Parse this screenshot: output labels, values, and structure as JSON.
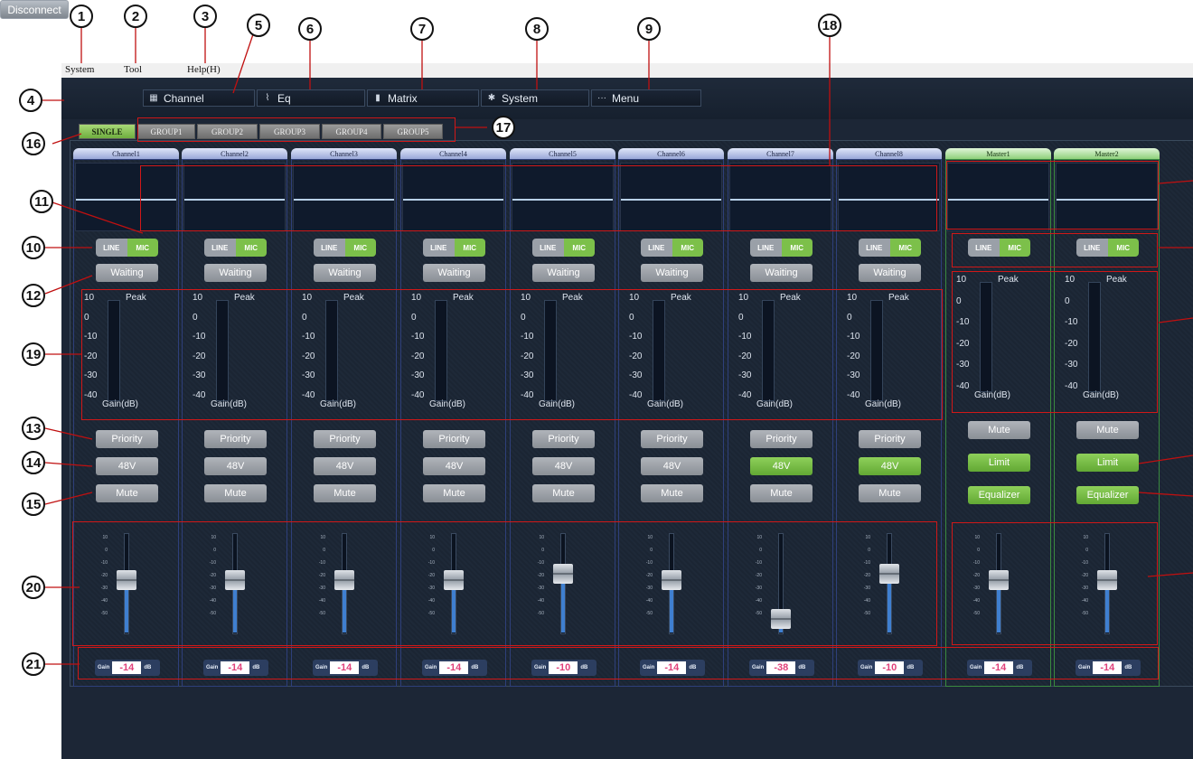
{
  "menu": {
    "system": "System",
    "tool": "Tool",
    "help": "Help(H)"
  },
  "toolbar": {
    "disconnect": "Disconnect",
    "channel": "Channel",
    "eq": "Eq",
    "matrix": "Matrix",
    "system": "System",
    "menu": "Menu"
  },
  "tabs": [
    "SINGLE",
    "GROUP1",
    "GROUP2",
    "GROUP3",
    "GROUP4",
    "GROUP5"
  ],
  "active_tab": "SINGLE",
  "meter_labels": {
    "peak": "Peak",
    "gain": "Gain(dB)",
    "ticks": [
      "10",
      "0",
      "-10",
      "-20",
      "-30",
      "-40"
    ]
  },
  "fader_ticks": [
    "10",
    "0",
    "-10",
    "-20",
    "-30",
    "-40",
    "-50"
  ],
  "switch": {
    "line": "LINE",
    "mic": "MIC"
  },
  "gain_box": {
    "prefix": "Gain",
    "unit": "dB"
  },
  "channels": [
    {
      "name": "Channel1",
      "status": "Waiting",
      "priority": "Priority",
      "phantom": "48V",
      "phantom_on": false,
      "mute": "Mute",
      "gain": "-14",
      "fader_db": -14
    },
    {
      "name": "Channel2",
      "status": "Waiting",
      "priority": "Priority",
      "phantom": "48V",
      "phantom_on": false,
      "mute": "Mute",
      "gain": "-14",
      "fader_db": -14
    },
    {
      "name": "Channel3",
      "status": "Waiting",
      "priority": "Priority",
      "phantom": "48V",
      "phantom_on": false,
      "mute": "Mute",
      "gain": "-14",
      "fader_db": -14
    },
    {
      "name": "Channel4",
      "status": "Waiting",
      "priority": "Priority",
      "phantom": "48V",
      "phantom_on": false,
      "mute": "Mute",
      "gain": "-14",
      "fader_db": -14
    },
    {
      "name": "Channel5",
      "status": "Waiting",
      "priority": "Priority",
      "phantom": "48V",
      "phantom_on": false,
      "mute": "Mute",
      "gain": "-10",
      "fader_db": -10
    },
    {
      "name": "Channel6",
      "status": "Waiting",
      "priority": "Priority",
      "phantom": "48V",
      "phantom_on": false,
      "mute": "Mute",
      "gain": "-14",
      "fader_db": -14
    },
    {
      "name": "Channel7",
      "status": "Waiting",
      "priority": "Priority",
      "phantom": "48V",
      "phantom_on": true,
      "mute": "Mute",
      "gain": "-38",
      "fader_db": -38
    },
    {
      "name": "Channel8",
      "status": "Waiting",
      "priority": "Priority",
      "phantom": "48V",
      "phantom_on": true,
      "mute": "Mute",
      "gain": "-10",
      "fader_db": -10
    }
  ],
  "masters": [
    {
      "name": "Master1",
      "mute": "Mute",
      "limit": "Limit",
      "equalizer": "Equalizer",
      "gain": "-14",
      "fader_db": -14
    },
    {
      "name": "Master2",
      "mute": "Mute",
      "limit": "Limit",
      "equalizer": "Equalizer",
      "gain": "-14",
      "fader_db": -14
    }
  ],
  "callouts": [
    "1",
    "2",
    "3",
    "4",
    "5",
    "6",
    "7",
    "8",
    "9",
    "10",
    "11",
    "12",
    "13",
    "14",
    "15",
    "16",
    "17",
    "18",
    "19",
    "20",
    "21"
  ]
}
